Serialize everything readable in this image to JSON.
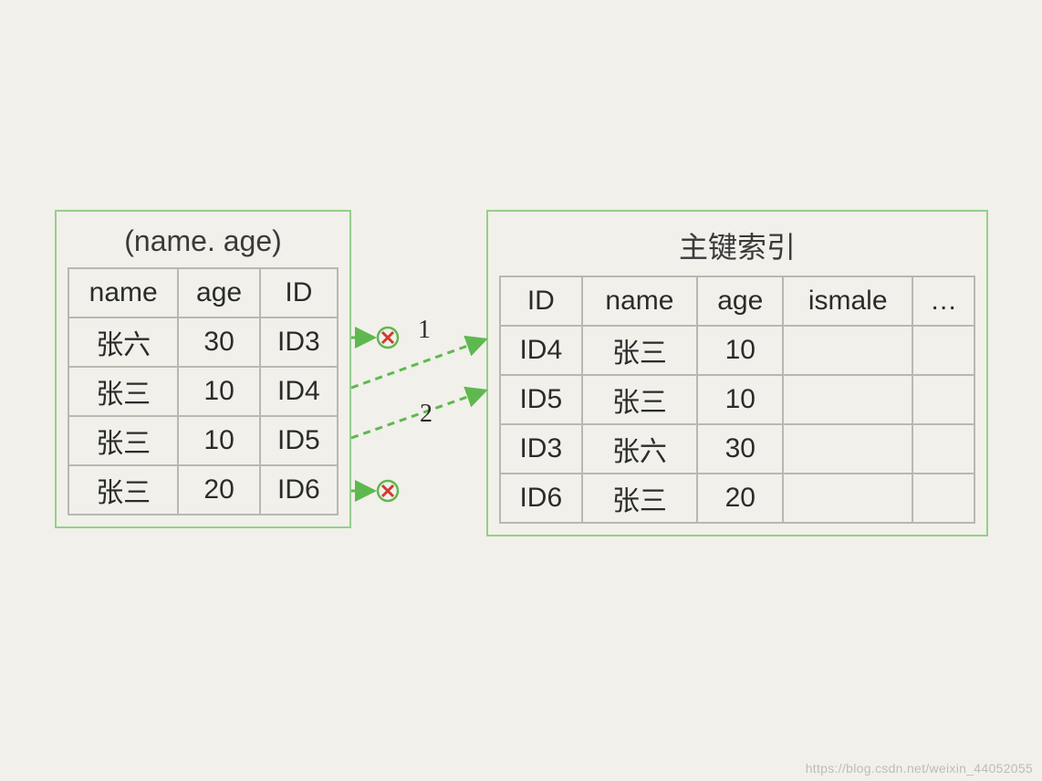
{
  "left_table": {
    "title": "(name. age)",
    "headers": [
      "name",
      "age",
      "ID"
    ],
    "rows": [
      [
        "张六",
        "30",
        "ID3"
      ],
      [
        "张三",
        "10",
        "ID4"
      ],
      [
        "张三",
        "10",
        "ID5"
      ],
      [
        "张三",
        "20",
        "ID6"
      ]
    ]
  },
  "right_table": {
    "title": "主键索引",
    "headers": [
      "ID",
      "name",
      "age",
      "ismale",
      "…"
    ],
    "rows": [
      [
        "ID4",
        "张三",
        "10",
        "",
        ""
      ],
      [
        "ID5",
        "张三",
        "10",
        "",
        ""
      ],
      [
        "ID3",
        "张六",
        "30",
        "",
        ""
      ],
      [
        "ID6",
        "张三",
        "20",
        "",
        ""
      ]
    ]
  },
  "arrows": {
    "label1": "1",
    "label2": "2"
  },
  "watermark": "https://blog.csdn.net/weixin_44052055"
}
